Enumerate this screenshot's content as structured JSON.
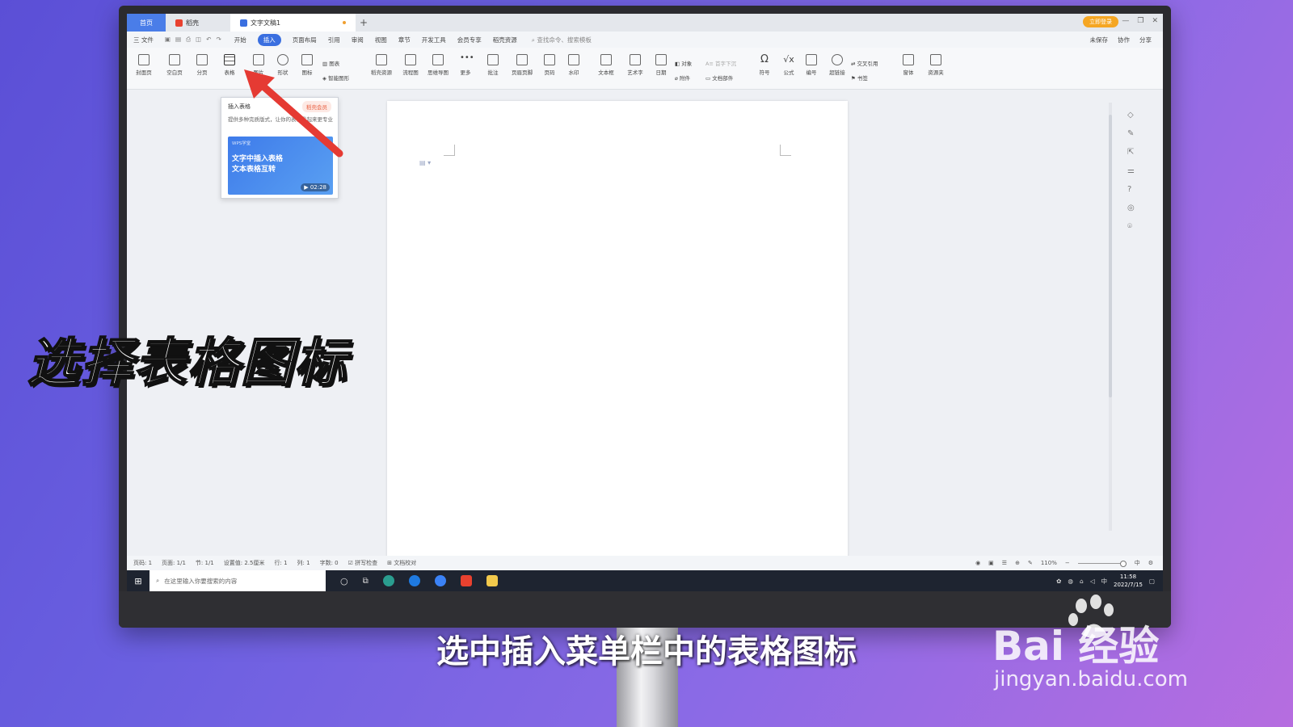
{
  "titlebar": {
    "home_tab": "首页",
    "wps_tab": "稻壳",
    "doc_tab": "文字文稿1",
    "plus": "+",
    "login": "立即登录"
  },
  "menubar": {
    "file": "三 文件",
    "items": [
      "开始",
      "插入",
      "页面布局",
      "引用",
      "审阅",
      "视图",
      "章节",
      "开发工具",
      "会员专享",
      "稻壳资源"
    ],
    "active_index": 1,
    "search": "查找命令、搜索模板",
    "right": [
      "未保存",
      "协作",
      "分享"
    ]
  },
  "ribbon": {
    "buttons": [
      "封面页",
      "空白页",
      "分页",
      "表格",
      "图片",
      "形状",
      "图标"
    ],
    "small_top": "图表",
    "small_bottom": "智能图形",
    "buttons2": [
      "稻壳资源",
      "流程图",
      "思维导图",
      "更多",
      "批注",
      "页眉页脚",
      "页码",
      "水印",
      "文本框",
      "艺术字",
      "日期"
    ],
    "object": "对象",
    "attach": "附件",
    "dropcap": "首字下沉",
    "docpart": "文档部件",
    "buttons3": [
      "符号",
      "公式",
      "编号",
      "超链接"
    ],
    "crossref": "交叉引用",
    "bookmark": "书签",
    "buttons4": [
      "窗体",
      "资源夹"
    ]
  },
  "popup": {
    "title": "插入表格",
    "badge": "稻壳会员",
    "desc": "提供多种完质版式，让你的表格看起来更专业",
    "video_tag": "WPS学堂",
    "video_line1": "文字中插入表格",
    "video_line2": "文本表格互转",
    "video_time": "02:28"
  },
  "statusbar": {
    "items": [
      "页码: 1",
      "页面: 1/1",
      "节: 1/1",
      "设置值: 2.5厘米",
      "行: 1",
      "列: 1",
      "字数: 0",
      "拼写检查",
      "文档校对"
    ],
    "zoom": "110%",
    "ime": "中"
  },
  "taskbar": {
    "search_placeholder": "在这里输入你要搜索的内容",
    "time": "11:58",
    "date": "2022/7/15",
    "ime": "中"
  },
  "overlay": {
    "big_caption": "选择表格图标",
    "subtitle": "选中插入菜单栏中的表格图标",
    "brand": "Bai  经验",
    "url": "jingyan.baidu.com"
  },
  "colors": {
    "accent": "#3a6fe0",
    "arrow": "#e53a33",
    "login": "#f5a623"
  }
}
